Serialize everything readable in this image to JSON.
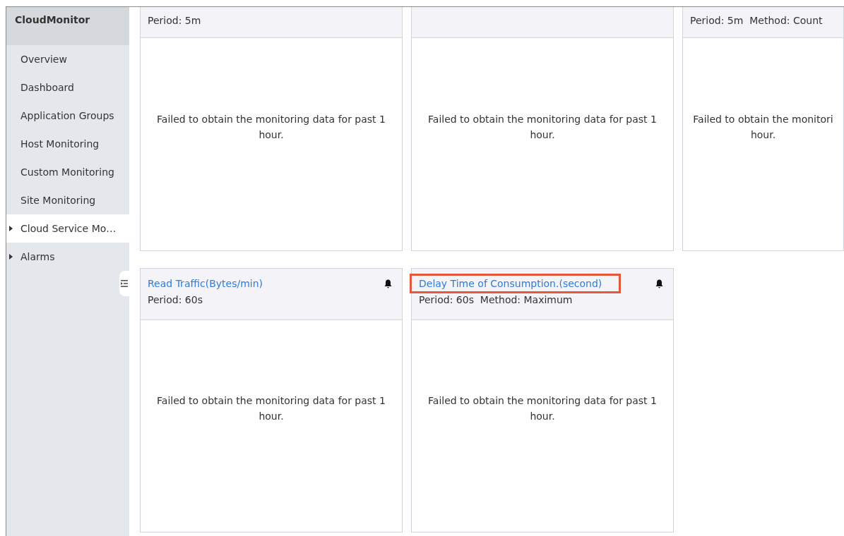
{
  "sidebar": {
    "title": "CloudMonitor",
    "items": [
      {
        "label": "Overview",
        "kind": "link",
        "selected": false
      },
      {
        "label": "Dashboard",
        "kind": "link",
        "selected": false
      },
      {
        "label": "Application Groups",
        "kind": "link",
        "selected": false
      },
      {
        "label": "Host Monitoring",
        "kind": "link",
        "selected": false
      },
      {
        "label": "Custom Monitoring",
        "kind": "link",
        "selected": false
      },
      {
        "label": "Site Monitoring",
        "kind": "link",
        "selected": false
      },
      {
        "label": "Cloud Service Mo…",
        "kind": "group",
        "selected": true,
        "expanded": false
      },
      {
        "label": "Alarms",
        "kind": "group",
        "selected": false,
        "expanded": false
      }
    ]
  },
  "rows": [
    {
      "cards": [
        {
          "meta": "Period: 5m",
          "message_lines": [
            "Failed to obtain the monitoring data for past 1",
            "hour."
          ]
        },
        {
          "message_lines": [
            "Failed to obtain the monitoring data for past 1",
            "hour."
          ]
        },
        {
          "meta": "Period: 5m  Method: Count",
          "message_lines": [
            "Failed to obtain the monitori",
            "hour."
          ]
        }
      ]
    },
    {
      "cards": [
        {
          "title": "Read Traffic(Bytes/min)",
          "highlighted": false,
          "alarm": true,
          "meta": "Period: 60s",
          "message_lines": [
            "Failed to obtain the monitoring data for past 1",
            "hour."
          ]
        },
        {
          "title": "Delay Time of Consumption.(second)",
          "highlighted": true,
          "alarm": true,
          "meta": "Period: 60s  Method: Maximum",
          "message_lines": [
            "Failed to obtain the monitoring data for past 1",
            "hour."
          ]
        }
      ]
    }
  ]
}
